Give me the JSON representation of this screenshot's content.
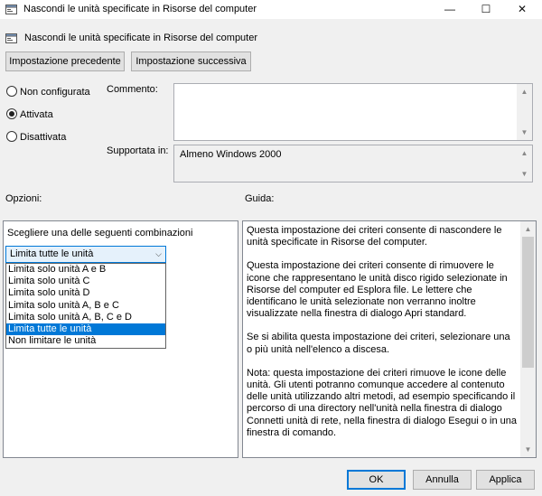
{
  "window": {
    "title": "Nascondi le unità specificate in Risorse del computer",
    "controls": {
      "minimize": "—",
      "maximize": "☐",
      "close": "✕"
    }
  },
  "header": {
    "policy_title": "Nascondi le unità specificate in Risorse del computer",
    "prev_button": "Impostazione precedente",
    "next_button": "Impostazione successiva"
  },
  "state": {
    "options": [
      {
        "label": "Non configurata",
        "checked": false
      },
      {
        "label": "Attivata",
        "checked": true
      },
      {
        "label": "Disattivata",
        "checked": false
      }
    ]
  },
  "comment": {
    "label": "Commento:",
    "value": ""
  },
  "supported": {
    "label": "Supportata in:",
    "value": "Almeno Windows 2000"
  },
  "options_section": {
    "label": "Opzioni:",
    "combo_prompt": "Scegliere una delle seguenti combinazioni",
    "combo_value": "Limita tutte le unità",
    "items": [
      "Limita solo unità A e B",
      "Limita solo unità C",
      "Limita solo unità D",
      "Limita solo unità A, B e C",
      "Limita solo unità A, B, C e D",
      "Limita tutte le unità",
      "Non limitare le unità"
    ],
    "selected_index": 5
  },
  "guide": {
    "label": "Guida:",
    "paragraphs": [
      "Questa impostazione dei criteri consente di nascondere le unità specificate in Risorse del computer.",
      "Questa impostazione dei criteri consente di rimuovere le icone che rappresentano le unità disco rigido selezionate in Risorse del computer ed Esplora file. Le lettere che identificano le unità selezionate non verranno inoltre visualizzate nella finestra di dialogo Apri standard.",
      "Se si abilita questa impostazione dei criteri, selezionare una o più unità nell'elenco a discesa.",
      "Nota: questa impostazione dei criteri rimuove le icone delle unità. Gli utenti potranno comunque accedere al contenuto delle unità utilizzando altri metodi, ad esempio specificando il percorso di una directory nell'unità nella finestra di dialogo Connetti unità di rete, nella finestra di dialogo Esegui o in una finestra di comando."
    ]
  },
  "footer": {
    "ok": "OK",
    "cancel": "Annulla",
    "apply": "Applica"
  },
  "colors": {
    "accent": "#0078d7",
    "selection": "#0078d7",
    "combo_bg": "#e5f1fb"
  }
}
